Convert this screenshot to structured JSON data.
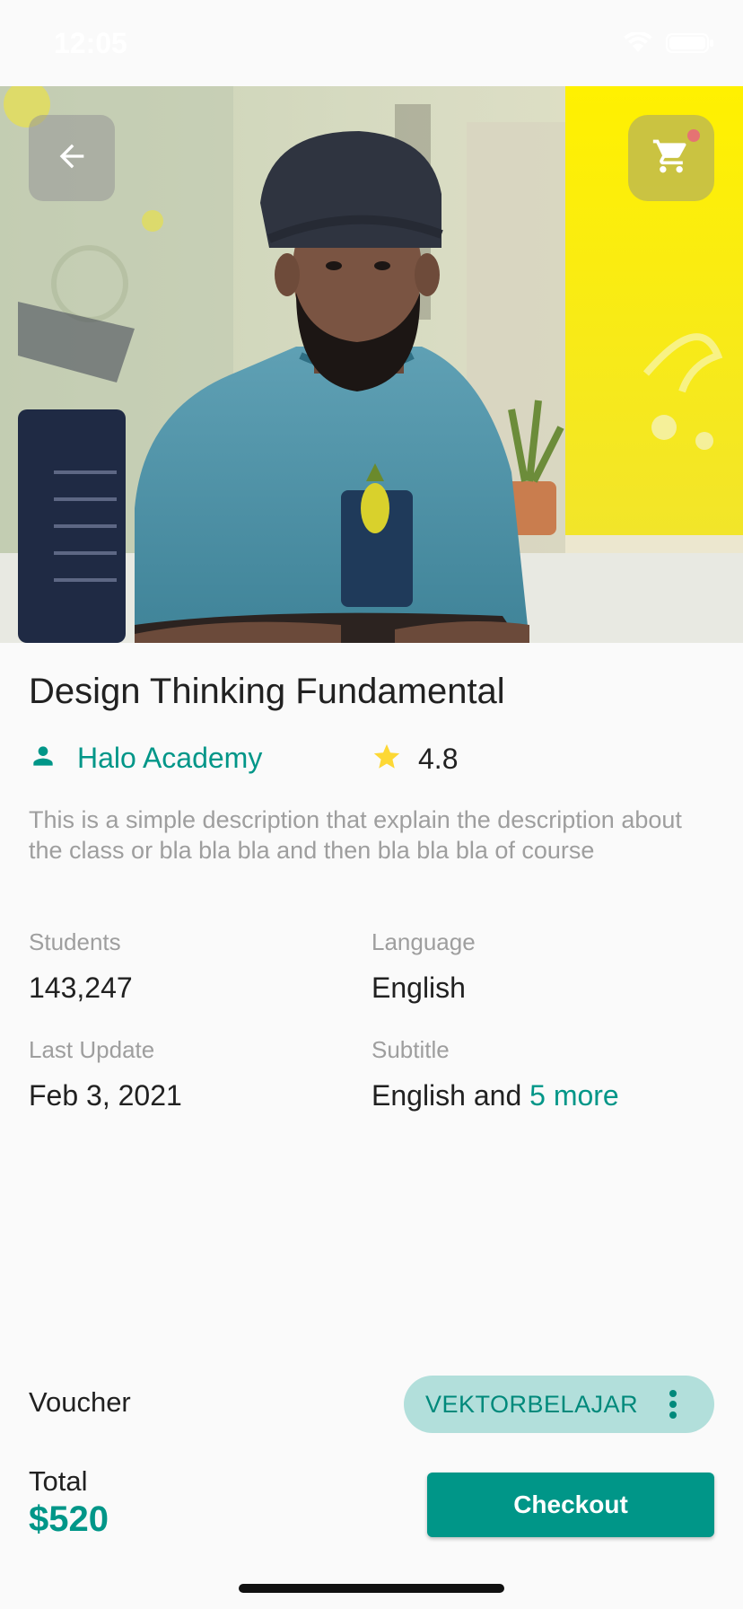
{
  "status_bar": {
    "time": "12:05"
  },
  "header": {
    "back_icon": "arrow-left-icon",
    "cart_icon": "shopping-cart-icon",
    "cart_badge_color": "#e57373"
  },
  "course": {
    "title": "Design Thinking Fundamental",
    "provider_icon": "person-icon",
    "provider": "Halo Academy",
    "rating_icon": "star-icon",
    "rating": "4.8",
    "description": "This is a simple description that explain the description about the class or bla bla bla and then bla bla bla of course"
  },
  "info": {
    "students_label": "Students",
    "students_value": "143,247",
    "language_label": "Language",
    "language_value": "English",
    "last_update_label": "Last Update",
    "last_update_value": "Feb 3, 2021",
    "subtitle_label": "Subtitle",
    "subtitle_value": "English and",
    "subtitle_more": "5 more"
  },
  "checkout": {
    "voucher_label": "Voucher",
    "voucher_code": "VEKTORBELAJAR",
    "voucher_menu_icon": "more-vertical-icon",
    "total_label": "Total",
    "total_value": "$520",
    "button_label": "Checkout"
  },
  "colors": {
    "accent": "#009688",
    "chip_background": "#b2dfdb",
    "star": "#fdd835",
    "muted_text": "#9e9e9e"
  }
}
